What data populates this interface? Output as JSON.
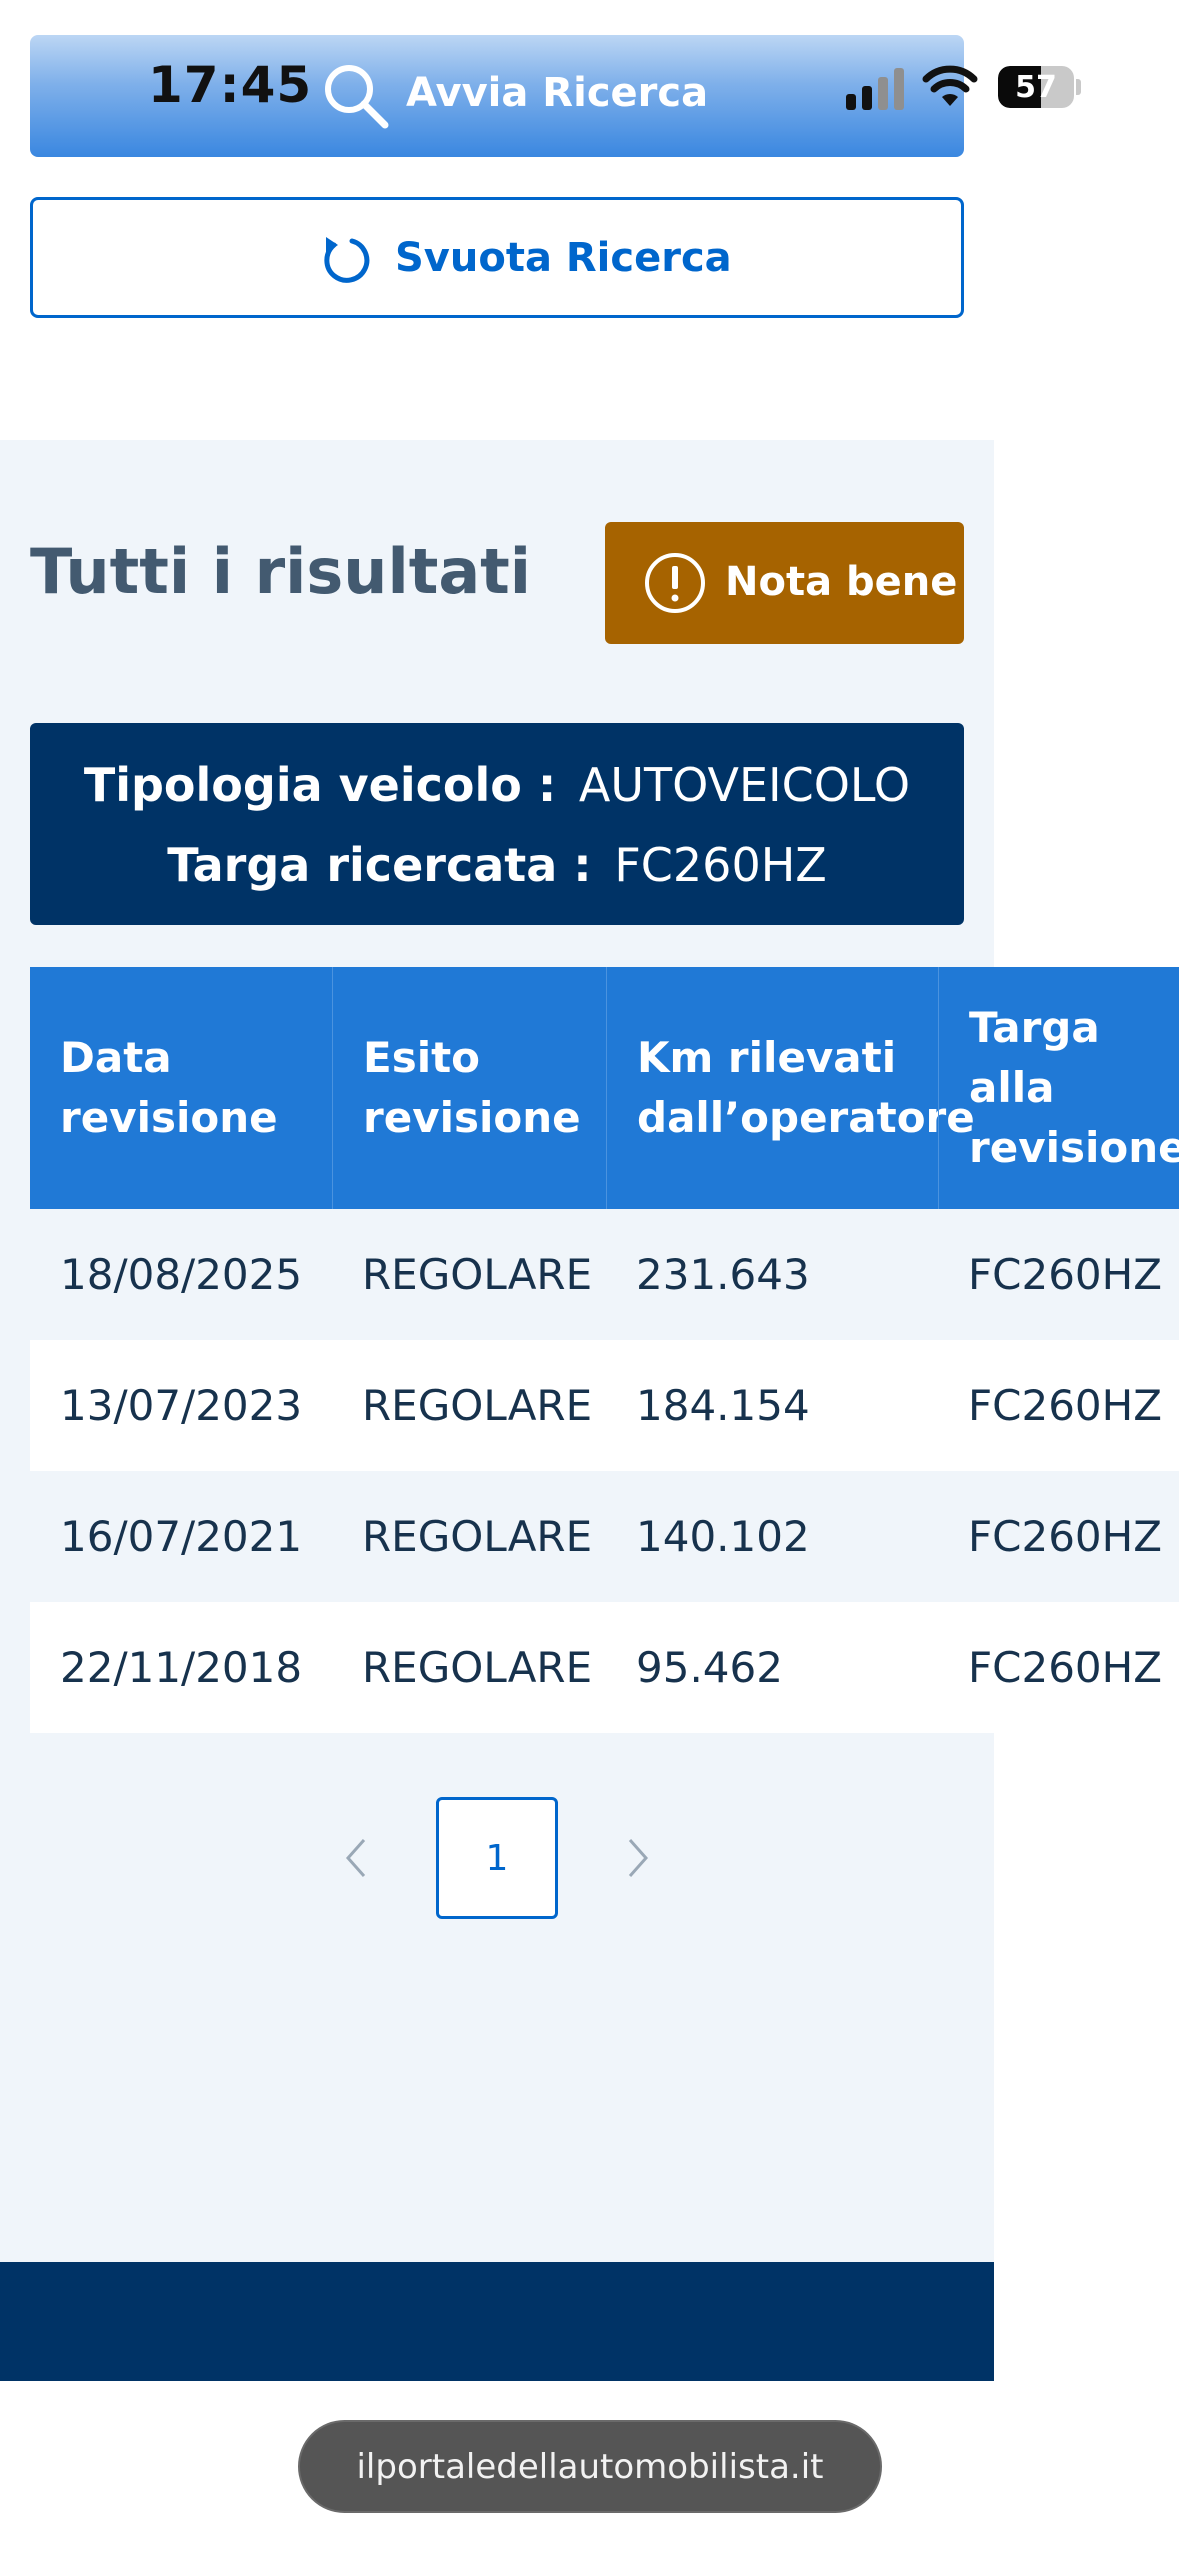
{
  "status_bar": {
    "time": "17:45",
    "battery": "57",
    "battery_level": 0.57,
    "signal_icon": "cellular-signal-icon",
    "wifi_icon": "wifi-icon"
  },
  "search": {
    "button_label": "Avvia Ricerca",
    "button_icon": "search-icon",
    "clear_label": "Svuota Ricerca",
    "clear_icon": "refresh-icon"
  },
  "results": {
    "title": "Tutti i risultati",
    "note_label": "Nota bene",
    "note_icon": "exclamation-icon",
    "vehicle_type_label": "Tipologia veicolo :",
    "vehicle_type_value": "AUTOVEICOLO",
    "plate_label": "Targa ricercata :",
    "plate_value": "FC260HZ"
  },
  "table": {
    "headers": [
      "Data\nrevisione",
      "Esito\nrevisione",
      "Km rilevati\ndall’operatore",
      "Targa\nalla\nrevisione"
    ],
    "rows": [
      [
        "18/08/2025",
        "REGOLARE",
        "231.643",
        "FC260HZ"
      ],
      [
        "13/07/2023",
        "REGOLARE",
        "184.154",
        "FC260HZ"
      ],
      [
        "16/07/2021",
        "REGOLARE",
        "140.102",
        "FC260HZ"
      ],
      [
        "22/11/2018",
        "REGOLARE",
        "95.462",
        "FC260HZ"
      ]
    ]
  },
  "pagination": {
    "current_page": "1",
    "prev_icon": "chevron-left-icon",
    "next_icon": "chevron-right-icon"
  },
  "browser": {
    "url": "ilportaledellautomobilista.it"
  },
  "colors": {
    "primary": "#0066cc",
    "dark_blue": "#003366",
    "table_header": "#2079d6",
    "note_bg": "#a66300",
    "section_bg": "#f0f5fa"
  }
}
